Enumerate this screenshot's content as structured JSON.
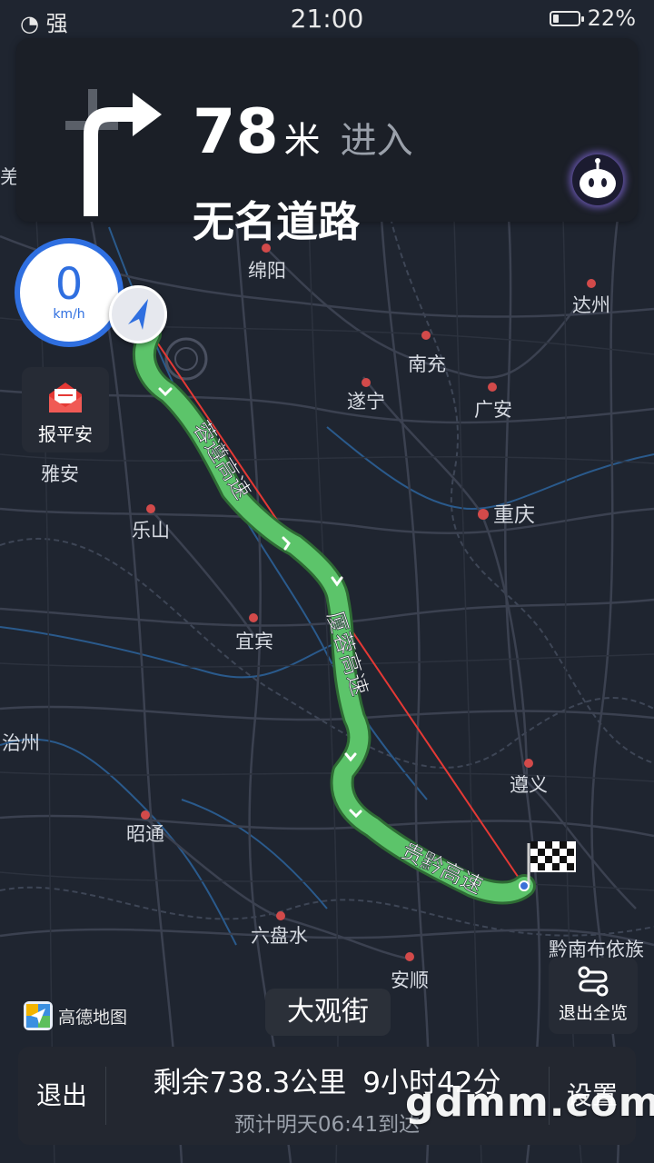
{
  "status_bar": {
    "signal_text": "强",
    "time": "21:00",
    "battery": "22%",
    "battery_level": 0.22
  },
  "guidance": {
    "distance": "78",
    "unit": "米",
    "action": "进入",
    "road": "无名道路",
    "turn": "turn-right"
  },
  "speed": {
    "value": "0",
    "unit": "km/h"
  },
  "safety": {
    "label": "报平安"
  },
  "map": {
    "cities": [
      "绵阳",
      "达州",
      "南充",
      "遂宁",
      "广安",
      "雅安",
      "重庆",
      "乐山",
      "宜宾",
      "遵义",
      "昭通",
      "六盘水",
      "安顺",
      "治州",
      "羌",
      "黔南布依族"
    ],
    "highways": [
      "蓉遵高速",
      "厦蓉高速",
      "贵黔高速"
    ],
    "route_color": "#5cc46a",
    "straight_line_color": "#e53935"
  },
  "logo": {
    "text": "高德地图"
  },
  "current_street": "大观街",
  "overview": {
    "label": "退出全览"
  },
  "bottom": {
    "exit": "退出",
    "summary_remaining": "剩余738.3公里",
    "summary_time": "9小时42分",
    "eta": "预计明天06:41到达",
    "settings": "设置"
  },
  "watermark": "gdmm.com"
}
